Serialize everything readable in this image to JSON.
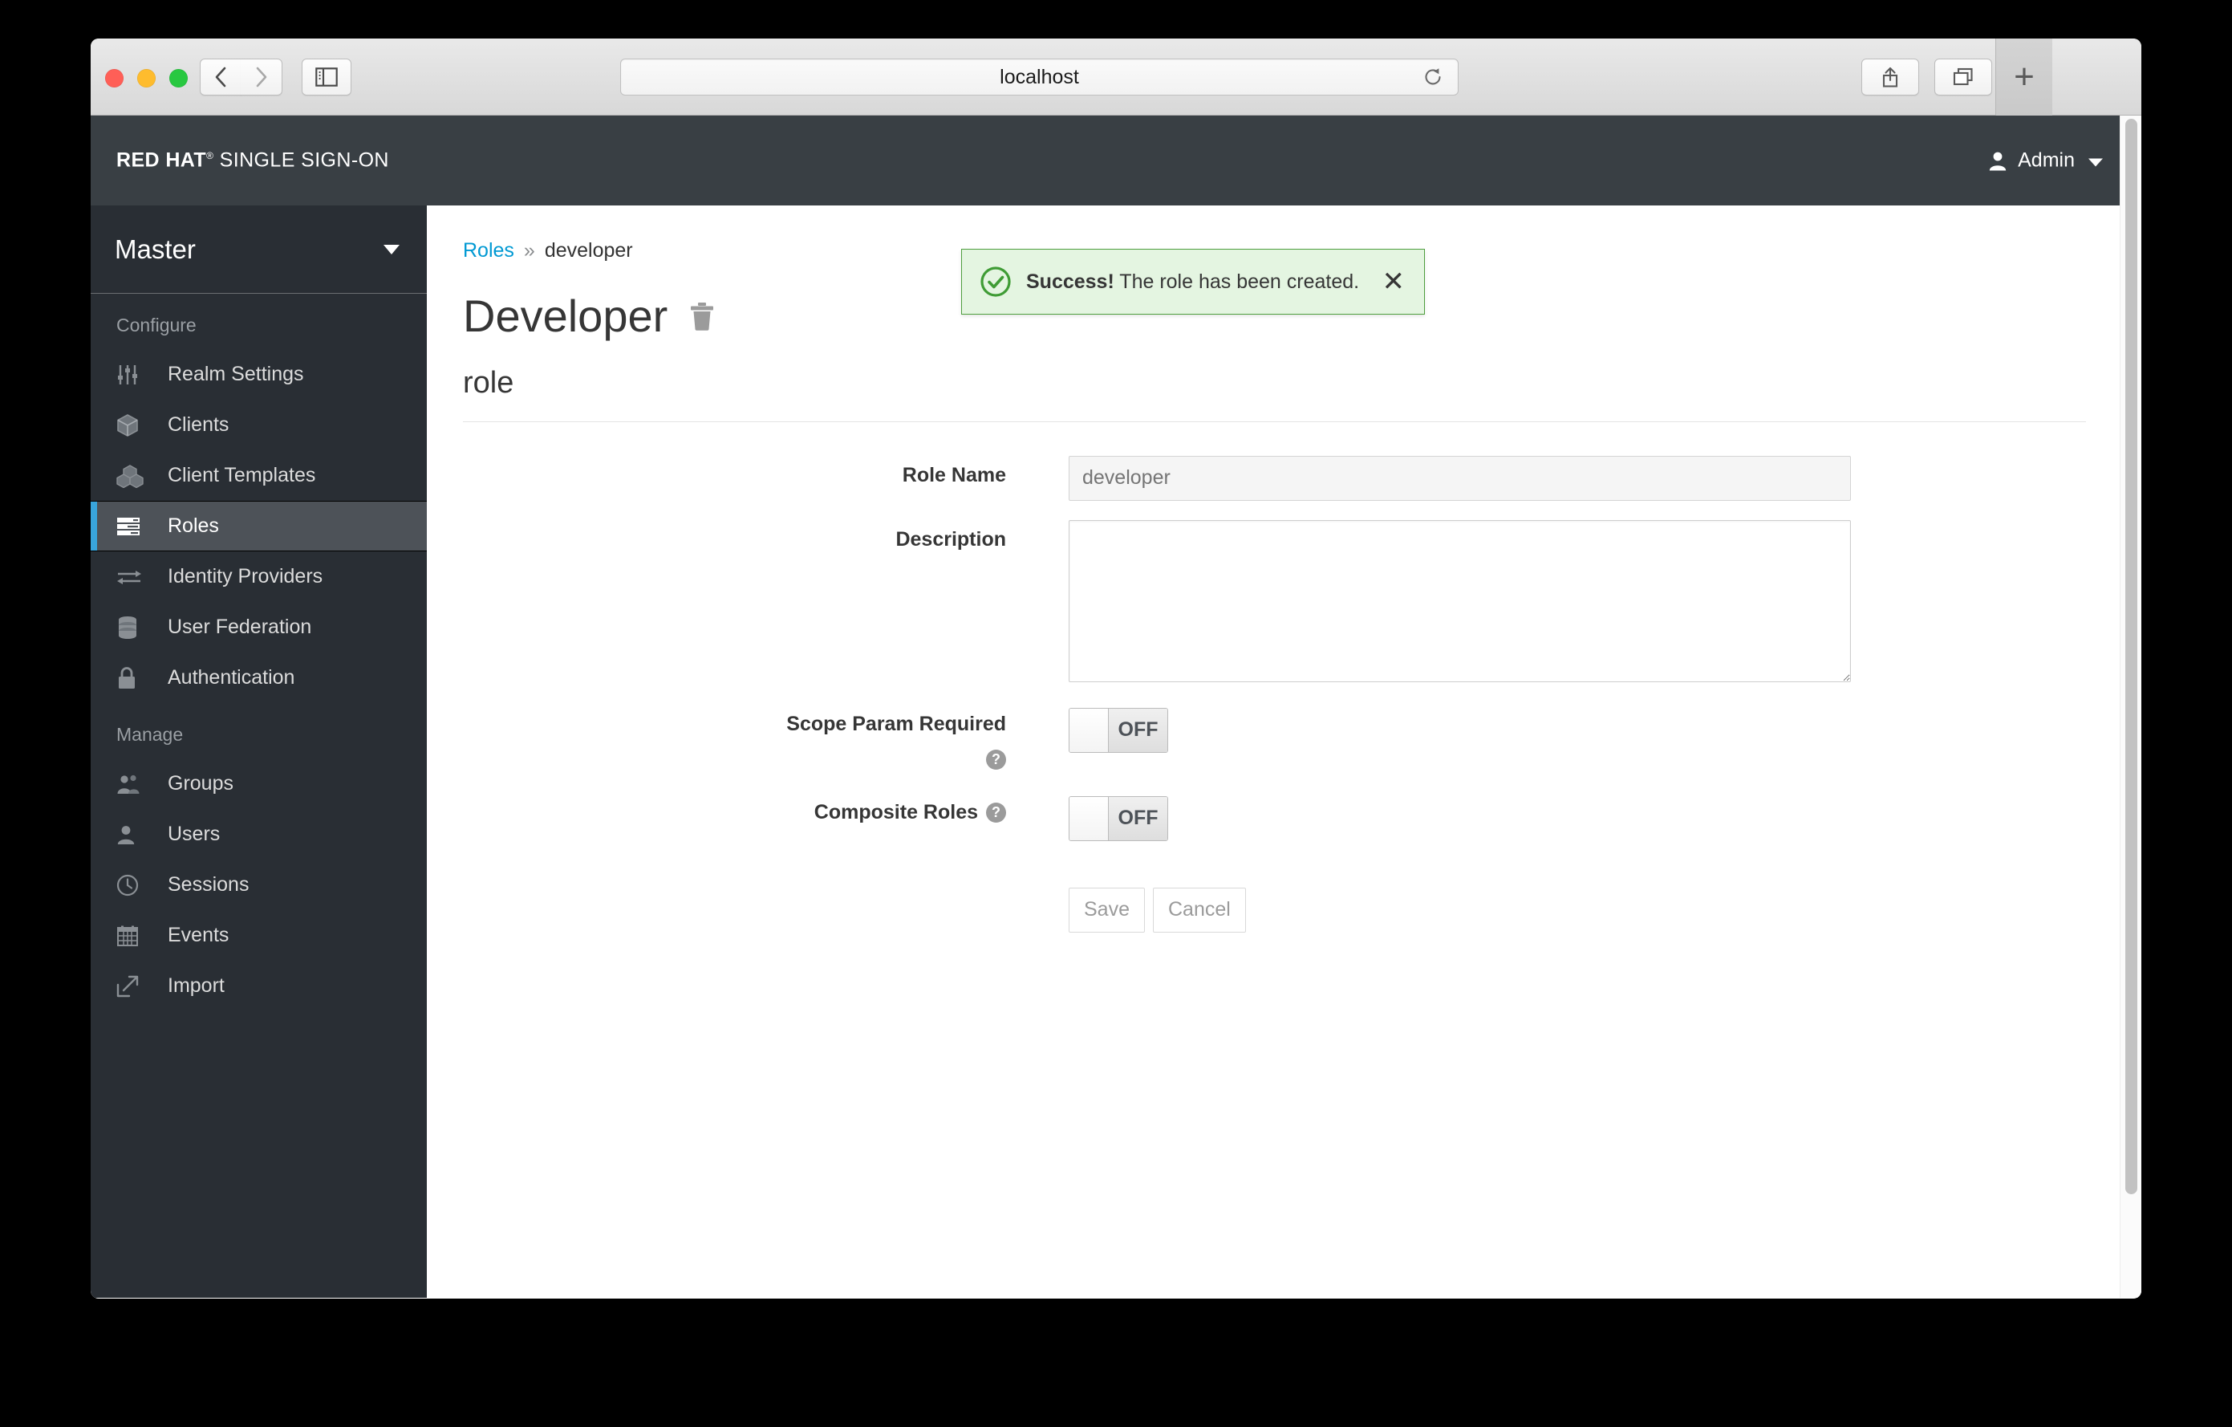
{
  "browser": {
    "address": "localhost",
    "back_label": "Back",
    "forward_label": "Forward",
    "sidebar_label": "Show Sidebar",
    "reload_label": "Reload",
    "share_label": "Share",
    "tabs_label": "Show Tab Overview",
    "new_tab_label": "+"
  },
  "header": {
    "brand_bold": "RED HAT",
    "brand_reg": "®",
    "brand_rest": "SINGLE SIGN-ON",
    "user": "Admin"
  },
  "alert": {
    "strong": "Success!",
    "message": "The role has been created.",
    "close_label": "✕",
    "bg_color": "#e4f5e1",
    "border_color": "#4e9e3e",
    "icon_color": "#3f9c35"
  },
  "sidebar": {
    "realm": "Master",
    "sections": [
      {
        "label": "Configure",
        "items": [
          {
            "label": "Realm Settings",
            "icon": "sliders-icon",
            "active": false
          },
          {
            "label": "Clients",
            "icon": "cube-icon",
            "active": false
          },
          {
            "label": "Client Templates",
            "icon": "cubes-icon",
            "active": false
          },
          {
            "label": "Roles",
            "icon": "rows-icon",
            "active": true
          },
          {
            "label": "Identity Providers",
            "icon": "exchange-arrows-icon",
            "active": false
          },
          {
            "label": "User Federation",
            "icon": "database-icon",
            "active": false
          },
          {
            "label": "Authentication",
            "icon": "lock-icon",
            "active": false
          }
        ]
      },
      {
        "label": "Manage",
        "items": [
          {
            "label": "Groups",
            "icon": "users-group-icon",
            "active": false
          },
          {
            "label": "Users",
            "icon": "user-icon",
            "active": false
          },
          {
            "label": "Sessions",
            "icon": "clock-icon",
            "active": false
          },
          {
            "label": "Events",
            "icon": "calendar-icon",
            "active": false
          },
          {
            "label": "Import",
            "icon": "import-arrow-icon",
            "active": false
          }
        ]
      }
    ],
    "accent_color": "#39a5dc",
    "bg_color": "#292e34"
  },
  "content": {
    "breadcrumb_root": "Roles",
    "breadcrumb_separator": "»",
    "breadcrumb_current": "developer",
    "page_title": "Developer",
    "delete_label": "Delete",
    "subheading": "role",
    "form": {
      "role_name": {
        "label": "Role Name",
        "value": "developer",
        "placeholder": "developer",
        "disabled": true
      },
      "description": {
        "label": "Description",
        "value": "",
        "placeholder": ""
      },
      "scope_param_required": {
        "label": "Scope Param Required",
        "state": "OFF",
        "help": "?"
      },
      "composite_roles": {
        "label": "Composite Roles",
        "state": "OFF",
        "help": "?"
      },
      "save_label": "Save",
      "cancel_label": "Cancel"
    }
  }
}
